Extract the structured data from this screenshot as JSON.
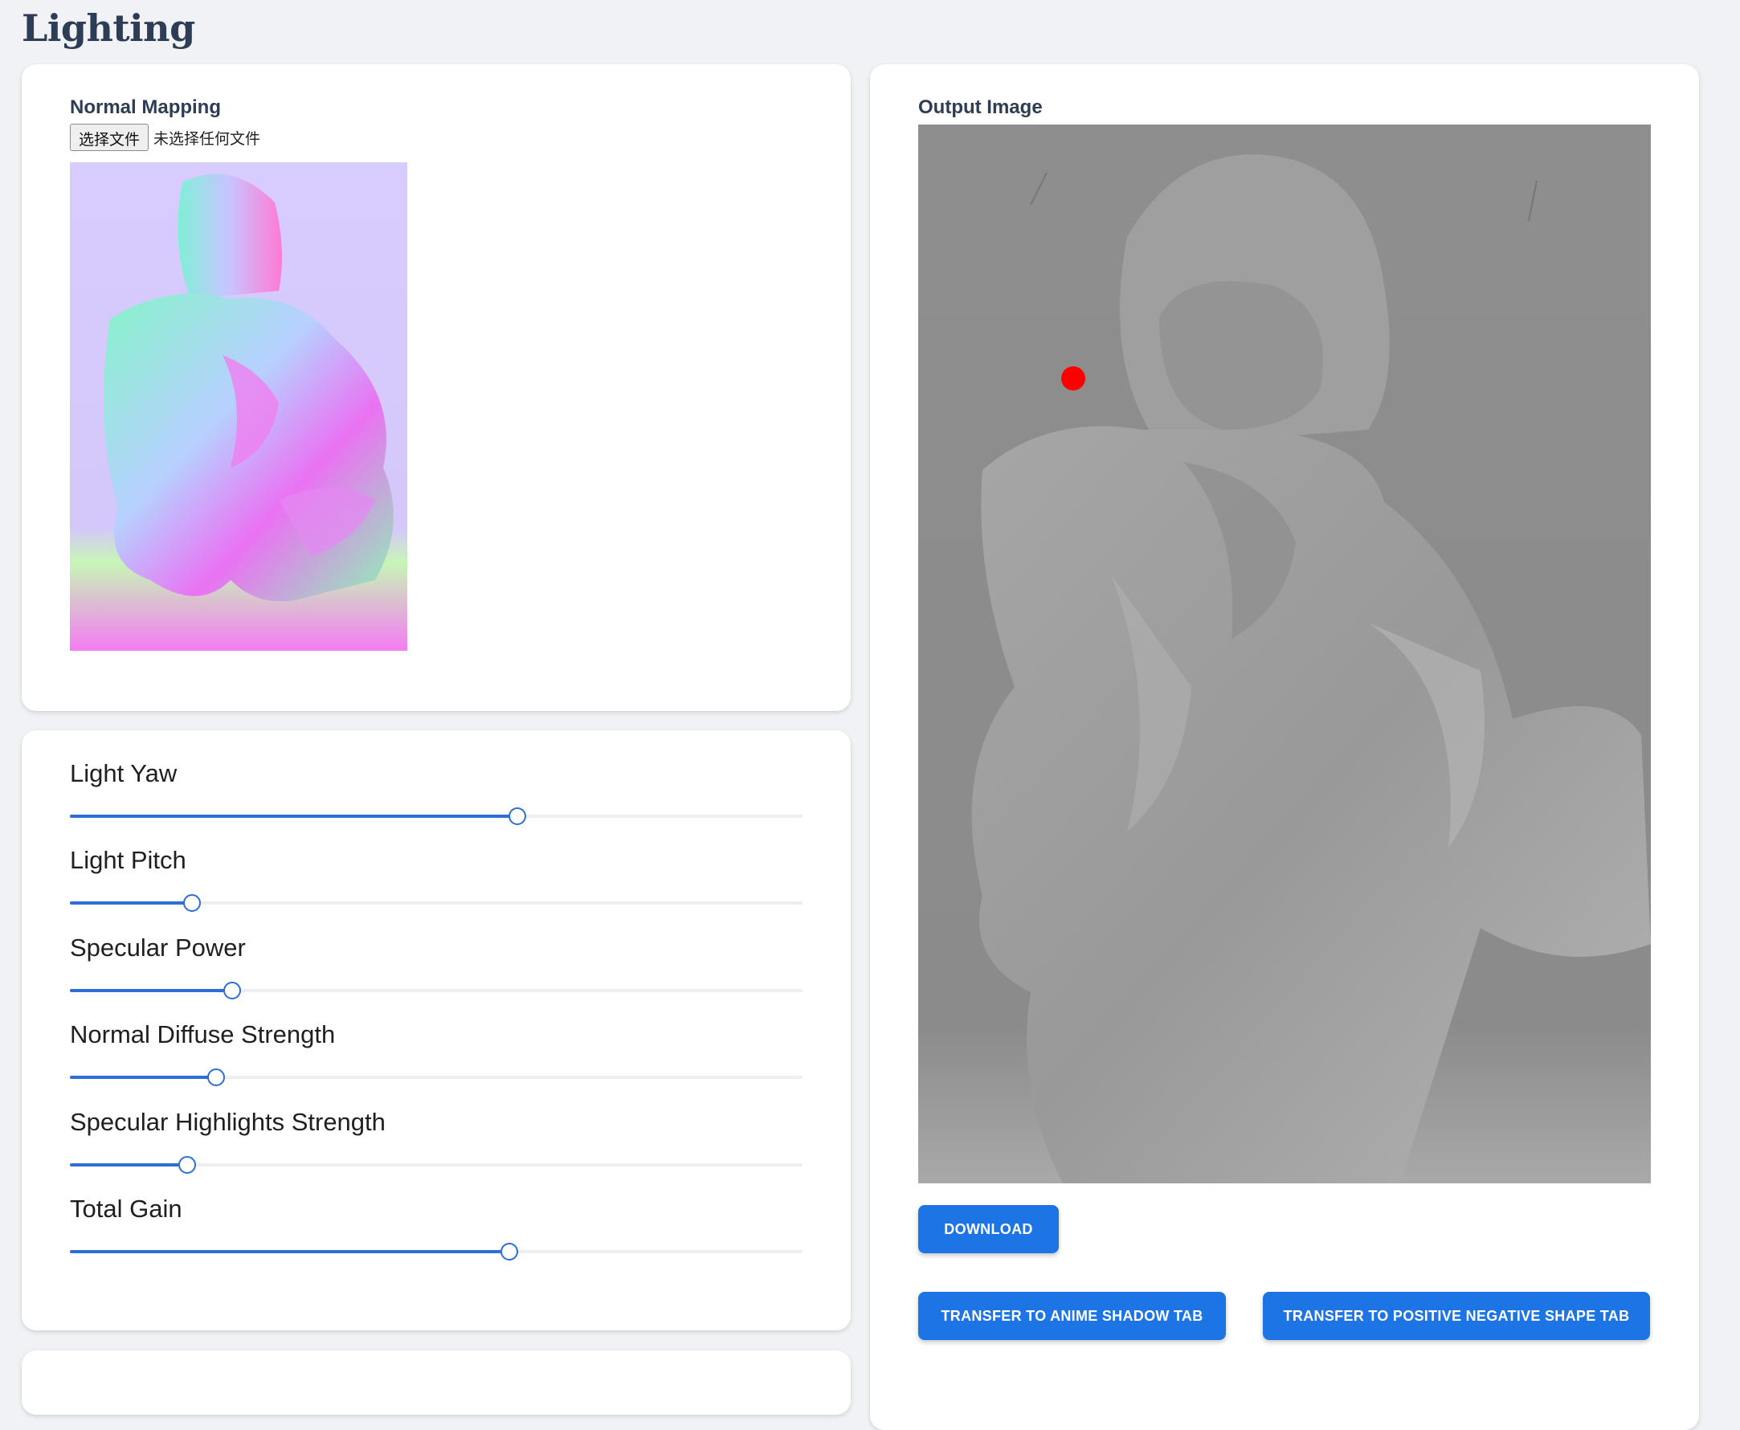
{
  "page": {
    "title": "Lighting"
  },
  "normal_mapping": {
    "label": "Normal Mapping",
    "file_button_label": "选择文件",
    "file_status": "未选择任何文件"
  },
  "sliders": [
    {
      "label": "Light Yaw",
      "fraction": 0.611
    },
    {
      "label": "Light Pitch",
      "fraction": 0.167
    },
    {
      "label": "Specular Power",
      "fraction": 0.222
    },
    {
      "label": "Normal Diffuse Strength",
      "fraction": 0.2
    },
    {
      "label": "Specular Highlights Strength",
      "fraction": 0.16
    },
    {
      "label": "Total Gain",
      "fraction": 0.6
    }
  ],
  "output": {
    "label": "Output Image",
    "download_label": "DOWNLOAD",
    "transfer_anime_label": "TRANSFER TO ANIME SHADOW TAB",
    "transfer_posneg_label": "TRANSFER TO POSITIVE NEGATIVE SHAPE TAB"
  },
  "colors": {
    "accent": "#1d74e5",
    "slider": "#2c6ed6",
    "light_marker": "#ff0000",
    "page_bg": "#f0f2f5"
  }
}
